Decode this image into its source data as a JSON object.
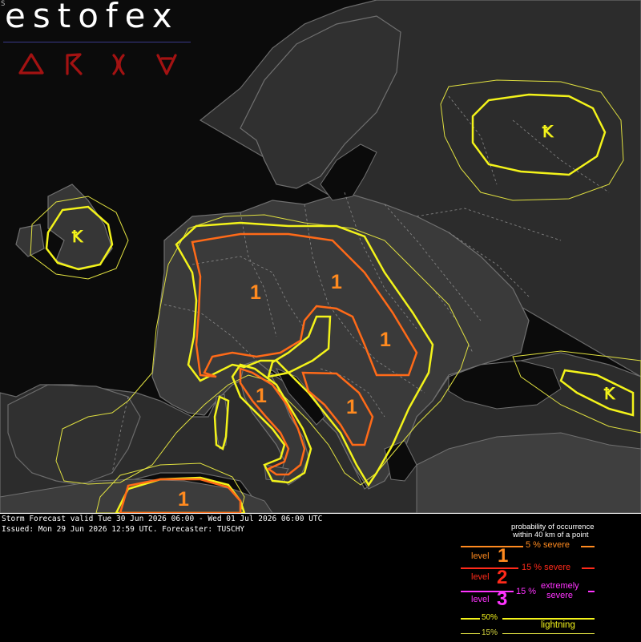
{
  "brand": {
    "logo_text": "estofex",
    "corner_mark": "S"
  },
  "header_icons": [
    "tornado-icon",
    "lightning-icon",
    "wind-icon",
    "hail-icon"
  ],
  "map": {
    "level1_labels": [
      "1",
      "1",
      "1",
      "1",
      "1",
      "1"
    ],
    "lightning_symbols": [
      "Ꝁ",
      "Ꝁ",
      "Ꝁ"
    ]
  },
  "forecast": {
    "valid_line": "Storm Forecast valid Tue 30 Jun 2026 06:00 - Wed 01 Jul 2026 06:00 UTC",
    "issued_line": "Issued: Mon 29 Jun 2026 12:59 UTC. Forecaster: TUSCHY"
  },
  "legend": {
    "header_line1": "probability of occurrence",
    "header_line2": "within 40 km of a point",
    "row5": "5 % severe",
    "level_word": "level",
    "level1_num": "1",
    "row15": "15 % severe",
    "level2_num": "2",
    "row15x_pct": "15 %",
    "row15x_text1": "extremely",
    "row15x_text2": "severe",
    "level3_num": "3",
    "lightning50": "50%",
    "lightning_label": "lightning",
    "lightning15": "15%",
    "colors": {
      "orange": "#ff8a1f",
      "red": "#ff2a1a",
      "magenta": "#ff33ff",
      "yellow": "#f3f31a",
      "lightning_line": "#d8d840"
    }
  }
}
